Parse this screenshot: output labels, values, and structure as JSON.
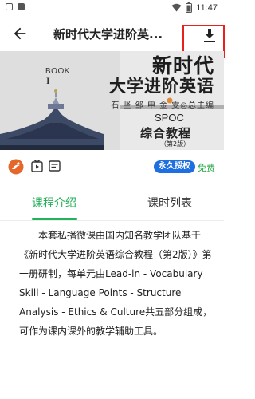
{
  "status_bar": {
    "time": "11:47",
    "icons": [
      "notification-icon",
      "notification-icon",
      "wifi-icon",
      "battery-icon"
    ]
  },
  "app_bar": {
    "title": "新时代大学进阶英...",
    "back_icon": "arrow-left-icon",
    "download_icon": "download-icon"
  },
  "banner": {
    "book_label": "BOOK",
    "book_number": "I",
    "title_line1": "新时代",
    "title_line2": "大学进阶英语",
    "editors": "石 坚  邹 申  金 雯◎总主编",
    "spoc": "SPOC",
    "subtitle": "综合教程",
    "edition": "（第2版）"
  },
  "info_row": {
    "icons": [
      "publisher-logo-icon",
      "video-icon",
      "document-icon"
    ],
    "license_badge": "永久授权",
    "price": "免费"
  },
  "tabs": [
    {
      "label": "课程介绍",
      "active": true
    },
    {
      "label": "课时列表",
      "active": false
    }
  ],
  "description": "本套私播微课由国内知名教学团队基于《新时代大学进阶英语综合教程（第2版）》第一册研制，每单元由Lead-in - Vocabulary Skill - Language Points - Structure Analysis - Ethics & Culture共五部分组成，可作为课内课外的教学辅助工具。",
  "colors": {
    "accent_green": "#25b05b",
    "badge_blue": "#1e6fe0",
    "highlight_red": "#e8211c"
  }
}
